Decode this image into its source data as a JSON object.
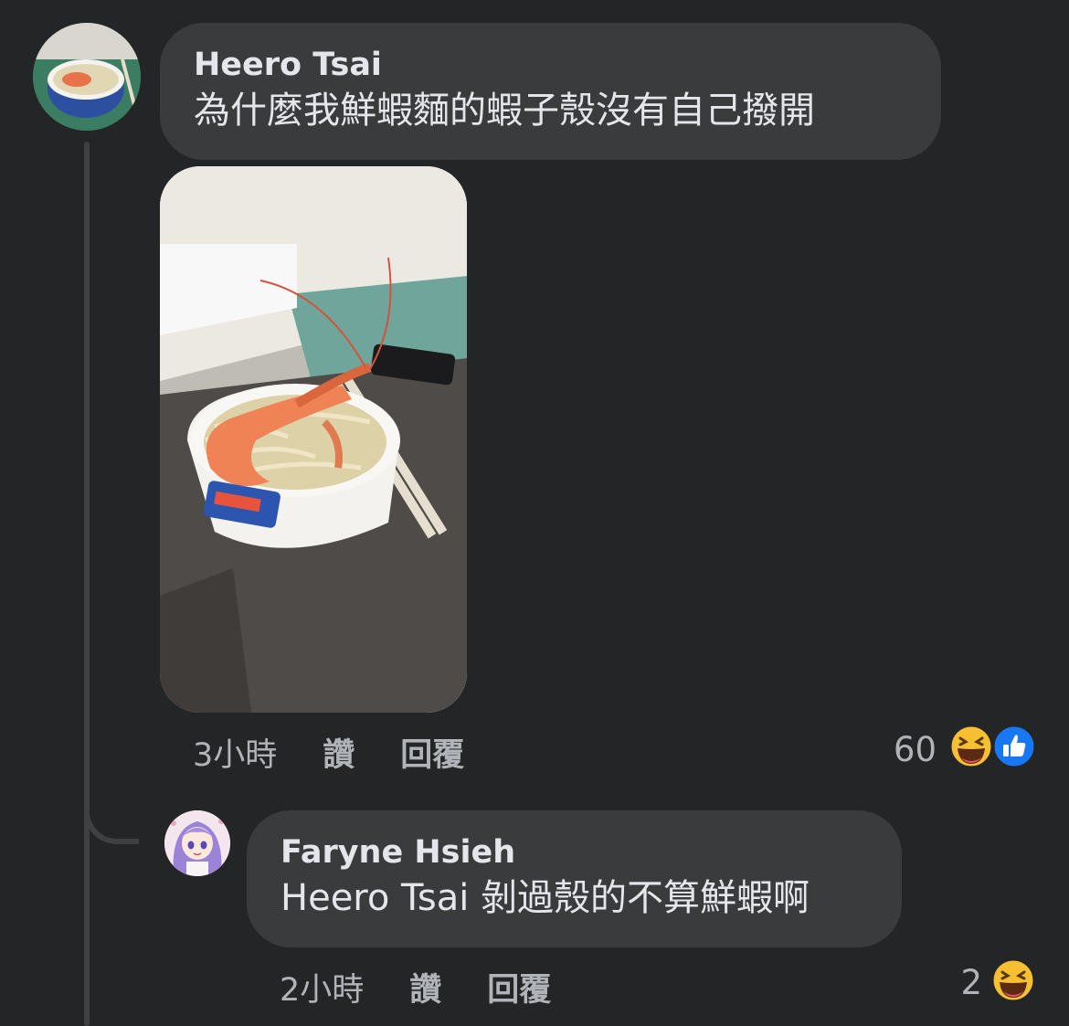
{
  "comments": [
    {
      "author": "Heero Tsai",
      "text": "為什麼我鮮蝦麵的蝦子殼沒有自己撥開",
      "time": "3小時",
      "like_label": "讚",
      "reply_label": "回覆",
      "reaction_count": "60",
      "reactions": [
        "haha-icon",
        "like-icon"
      ]
    },
    {
      "author": "Faryne Hsieh",
      "text": "Heero Tsai 剝過殼的不算鮮蝦啊",
      "time": "2小時",
      "like_label": "讚",
      "reply_label": "回覆",
      "reaction_count": "2",
      "reactions": [
        "haha-icon"
      ]
    }
  ],
  "colors": {
    "background": "#242526",
    "bubble": "#3a3b3c",
    "primary_text": "#e4e6eb",
    "secondary_text": "#b0b3b8",
    "like_blue": "#1877f2",
    "haha_yellow": "#f7c033"
  }
}
